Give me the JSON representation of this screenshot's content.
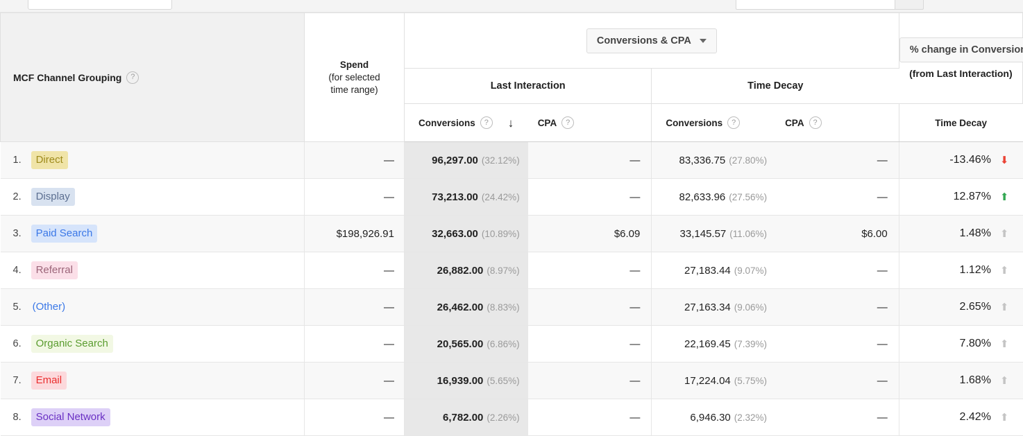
{
  "header": {
    "dimension_label": "MCF Channel Grouping",
    "dimension_help": "?",
    "spend_label": "Spend",
    "spend_sublabel_1": "(for selected",
    "spend_sublabel_2": "time range)",
    "metric_selector": "Conversions & CPA",
    "change_selector": "% change in Conversions",
    "change_sub": "(from Last Interaction)",
    "models": [
      {
        "name": "Last Interaction"
      },
      {
        "name": "Time Decay"
      }
    ],
    "metrics": {
      "conversions": "Conversions",
      "cpa": "CPA",
      "help": "?",
      "sort_arrow": "↓"
    },
    "change_column_header": "Time Decay"
  },
  "colors": {
    "sorted_column_bg": "#e8e8e8",
    "positive": "#34a853",
    "negative": "#ea4335",
    "neutral": "#c4c4c4",
    "header_bg": "#f1f1f1"
  },
  "rows": [
    {
      "rank": "1.",
      "channel": "Direct",
      "pill_bg": "#f0e4a8",
      "pill_fg": "#9e8b1c",
      "spend": "—",
      "li_conversions": "96,297.00",
      "li_pct": "(32.12%)",
      "li_cpa": "—",
      "td_conversions": "83,336.75",
      "td_pct": "(27.80%)",
      "td_cpa": "—",
      "change": "-13.46%",
      "change_dir": "down"
    },
    {
      "rank": "2.",
      "channel": "Display",
      "pill_bg": "#d8e2f0",
      "pill_fg": "#5c6f91",
      "spend": "—",
      "li_conversions": "73,213.00",
      "li_pct": "(24.42%)",
      "li_cpa": "—",
      "td_conversions": "82,633.96",
      "td_pct": "(27.56%)",
      "td_cpa": "—",
      "change": "12.87%",
      "change_dir": "up"
    },
    {
      "rank": "3.",
      "channel": "Paid Search",
      "pill_bg": "#d6e4fb",
      "pill_fg": "#3b78e7",
      "spend": "$198,926.91",
      "li_conversions": "32,663.00",
      "li_pct": "(10.89%)",
      "li_cpa": "$6.09",
      "td_conversions": "33,145.57",
      "td_pct": "(11.06%)",
      "td_cpa": "$6.00",
      "change": "1.48%",
      "change_dir": "flat"
    },
    {
      "rank": "4.",
      "channel": "Referral",
      "pill_bg": "#fbdfe8",
      "pill_fg": "#9c6579",
      "spend": "—",
      "li_conversions": "26,882.00",
      "li_pct": "(8.97%)",
      "li_cpa": "—",
      "td_conversions": "27,183.44",
      "td_pct": "(9.07%)",
      "td_cpa": "—",
      "change": "1.12%",
      "change_dir": "flat"
    },
    {
      "rank": "5.",
      "channel": "(Other)",
      "pill_bg": "transparent",
      "pill_fg": "#3b78e7",
      "spend": "—",
      "li_conversions": "26,462.00",
      "li_pct": "(8.83%)",
      "li_cpa": "—",
      "td_conversions": "27,163.34",
      "td_pct": "(9.06%)",
      "td_cpa": "—",
      "change": "2.65%",
      "change_dir": "flat"
    },
    {
      "rank": "6.",
      "channel": "Organic Search",
      "pill_bg": "#f2f8e4",
      "pill_fg": "#5a9c2f",
      "spend": "—",
      "li_conversions": "20,565.00",
      "li_pct": "(6.86%)",
      "li_cpa": "—",
      "td_conversions": "22,169.45",
      "td_pct": "(7.39%)",
      "td_cpa": "—",
      "change": "7.80%",
      "change_dir": "flat"
    },
    {
      "rank": "7.",
      "channel": "Email",
      "pill_bg": "#fcd9dc",
      "pill_fg": "#ea2f2f",
      "spend": "—",
      "li_conversions": "16,939.00",
      "li_pct": "(5.65%)",
      "li_cpa": "—",
      "td_conversions": "17,224.04",
      "td_pct": "(5.75%)",
      "td_cpa": "—",
      "change": "1.68%",
      "change_dir": "flat"
    },
    {
      "rank": "8.",
      "channel": "Social Network",
      "pill_bg": "#ddd0f7",
      "pill_fg": "#6a30c4",
      "spend": "—",
      "li_conversions": "6,782.00",
      "li_pct": "(2.26%)",
      "li_cpa": "—",
      "td_conversions": "6,946.30",
      "td_pct": "(2.32%)",
      "td_cpa": "—",
      "change": "2.42%",
      "change_dir": "flat"
    }
  ]
}
